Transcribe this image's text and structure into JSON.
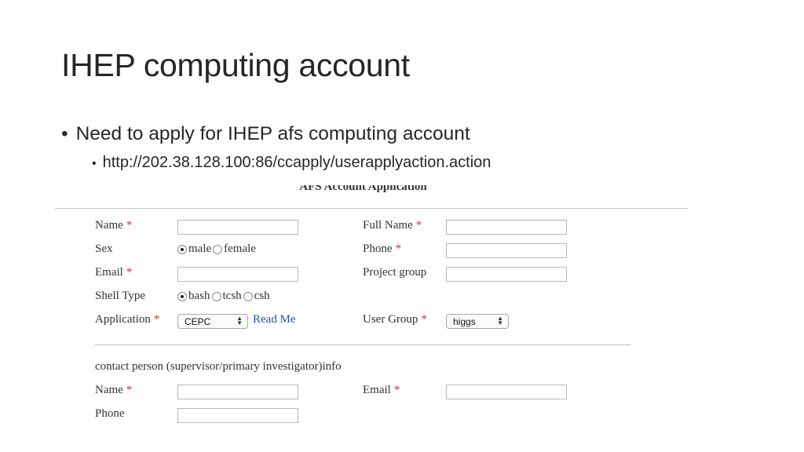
{
  "slide": {
    "title": "IHEP computing account",
    "bullet1": "Need to apply for IHEP afs computing account",
    "bullet2": "http://202.38.128.100:86/ccapply/userapplyaction.action"
  },
  "form": {
    "caption": "AFS Account Application",
    "required_mark": "*",
    "name_label": "Name",
    "full_name_label": "Full Name",
    "sex_label": "Sex",
    "sex_options": [
      "male",
      "female"
    ],
    "sex_selected": "male",
    "phone_label": "Phone",
    "email_label": "Email",
    "project_group_label": "Project group",
    "shell_type_label": "Shell Type",
    "shell_options": [
      "bash",
      "tcsh",
      "csh"
    ],
    "shell_selected": "bash",
    "application_label": "Application",
    "application_value": "CEPC",
    "read_me_link": "Read Me",
    "user_group_label": "User Group",
    "user_group_value": "higgs"
  },
  "contact": {
    "heading": "contact person (supervisor/primary investigator)info",
    "name_label": "Name",
    "email_label": "Email",
    "phone_label": "Phone"
  }
}
